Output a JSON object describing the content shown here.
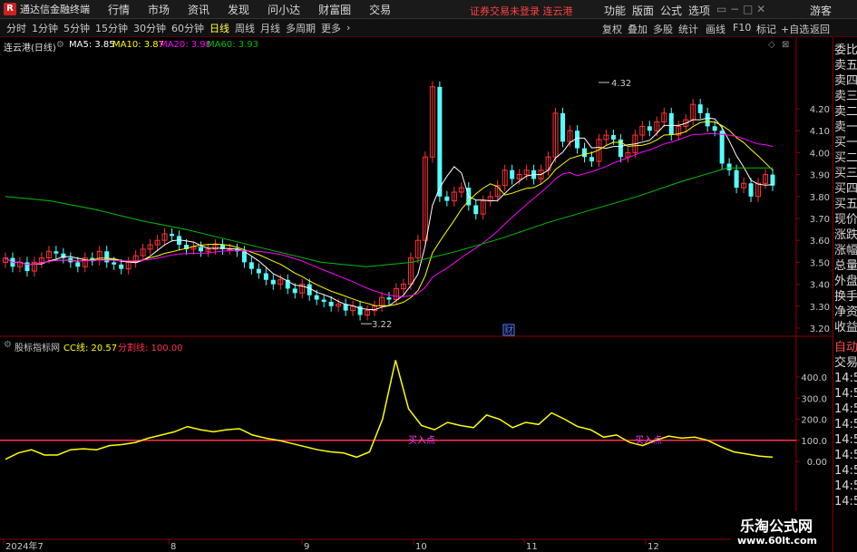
{
  "app": {
    "title": "通达信金融终端",
    "logo": "R"
  },
  "menu": {
    "items": [
      "行情",
      "市场",
      "资讯",
      "发现",
      "问小达",
      "财富圈",
      "交易"
    ],
    "warning": "证券交易未登录  连云港",
    "right": [
      "功能",
      "版面",
      "公式",
      "选项",
      "游客"
    ]
  },
  "periods": [
    "分时",
    "1分钟",
    "5分钟",
    "15分钟",
    "30分钟",
    "60分钟",
    "日线",
    "周线",
    "月线",
    "多周期",
    "更多"
  ],
  "active_period": "日线",
  "tools": [
    "复权",
    "叠加",
    "多股",
    "统计",
    "画线",
    "F10",
    "标记",
    "+自选",
    "返回"
  ],
  "right_panel": [
    "委比",
    "卖五",
    "卖四",
    "卖三",
    "卖二",
    "卖一",
    "买一",
    "买二",
    "买三",
    "买四",
    "买五",
    "现价",
    "涨跌",
    "涨幅",
    "总量",
    "外盘",
    "换手",
    "净资",
    "收益",
    "自动",
    "交易",
    "14:56",
    "14:56",
    "14:56",
    "14:56",
    "14:56",
    "14:56",
    "14:56",
    "14:56",
    "14:56"
  ],
  "main_legend": {
    "stock": "连云港(日线)",
    "ma5": "MA5: 3.85",
    "ma10": "MA10: 3.87",
    "ma20": "MA20: 3.98",
    "ma60": "MA60: 3.93"
  },
  "sub_legend": {
    "name": "股标指标网",
    "cc": "CC线: 20.57",
    "split": "分割线: 100.00"
  },
  "annotations": {
    "high": "4.32",
    "low": "3.22",
    "finance": "财",
    "buy1": "买入点",
    "buy2": "买入点"
  },
  "price_axis": [
    "4.20",
    "4.10",
    "4.00",
    "3.90",
    "3.80",
    "3.70",
    "3.60",
    "3.50",
    "3.40",
    "3.30",
    "3.20"
  ],
  "indicator_axis": [
    "400.0",
    "300.0",
    "200.0",
    "100.0",
    "0.00"
  ],
  "date_axis": [
    "2024年7",
    "8",
    "9",
    "10",
    "11",
    "12"
  ],
  "watermark": {
    "name": "乐淘公式网",
    "url": "www.60lt.com"
  },
  "colors": {
    "up": "#ff3232",
    "down": "#54ffff",
    "ma5": "#ffffff",
    "ma10": "#ffff00",
    "ma20": "#ff00ff",
    "ma60": "#00c000",
    "cc": "#ffff00",
    "split": "#ff3050"
  },
  "chart_data": {
    "type": "line",
    "price_candles_close": [
      3.52,
      3.48,
      3.5,
      3.46,
      3.5,
      3.52,
      3.55,
      3.54,
      3.52,
      3.5,
      3.48,
      3.52,
      3.51,
      3.55,
      3.5,
      3.49,
      3.47,
      3.5,
      3.53,
      3.56,
      3.58,
      3.6,
      3.63,
      3.62,
      3.58,
      3.56,
      3.57,
      3.55,
      3.56,
      3.58,
      3.56,
      3.56,
      3.55,
      3.5,
      3.47,
      3.45,
      3.42,
      3.4,
      3.42,
      3.38,
      3.36,
      3.4,
      3.35,
      3.33,
      3.32,
      3.3,
      3.31,
      3.28,
      3.3,
      3.26,
      3.28,
      3.3,
      3.34,
      3.33,
      3.38,
      3.4,
      3.52,
      3.6,
      3.98,
      4.3,
      3.8,
      3.78,
      3.82,
      3.84,
      3.76,
      3.72,
      3.78,
      3.8,
      3.85,
      3.92,
      3.88,
      3.9,
      3.92,
      3.88,
      3.92,
      3.98,
      4.18,
      4.05,
      4.1,
      4.02,
      3.98,
      3.96,
      4.06,
      4.08,
      4.06,
      3.98,
      4.0,
      4.08,
      4.12,
      4.1,
      4.14,
      4.18,
      4.08,
      4.12,
      4.15,
      4.22,
      4.18,
      4.12,
      4.1,
      3.95,
      3.92,
      3.84,
      3.86,
      3.8,
      3.86,
      3.9,
      3.85
    ],
    "ma60_path": [
      3.8,
      3.78,
      3.74,
      3.69,
      3.65,
      3.6,
      3.55,
      3.5,
      3.48,
      3.5,
      3.55,
      3.61,
      3.68,
      3.74,
      3.8,
      3.87,
      3.93,
      3.93
    ],
    "cc_values": [
      10,
      40,
      55,
      30,
      30,
      55,
      60,
      55,
      75,
      80,
      90,
      110,
      125,
      140,
      165,
      150,
      140,
      150,
      155,
      125,
      110,
      100,
      85,
      70,
      55,
      45,
      40,
      20,
      45,
      200,
      480,
      250,
      170,
      150,
      185,
      170,
      160,
      220,
      200,
      160,
      185,
      175,
      230,
      200,
      165,
      150,
      115,
      125,
      90,
      75,
      100,
      120,
      110,
      115,
      100,
      70,
      45,
      35,
      25,
      20
    ]
  }
}
